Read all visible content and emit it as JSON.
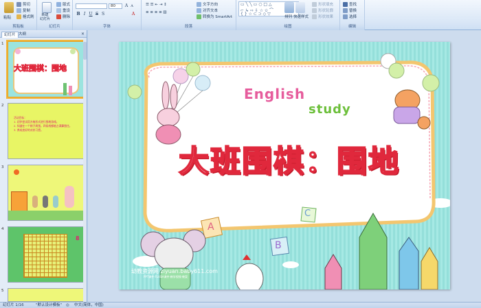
{
  "ribbon": {
    "clipboard": {
      "paste": "粘贴",
      "cut": "剪切",
      "copy": "复制",
      "format_painter": "格式刷",
      "group": "剪贴板"
    },
    "slides": {
      "new_slide": "新建\n幻灯片",
      "layout": "版式",
      "reset": "重设",
      "delete": "删除",
      "group": "幻灯片"
    },
    "font": {
      "font_name": "",
      "font_size": "80",
      "group": "字体"
    },
    "paragraph": {
      "text_direction": "文字方向",
      "align_text": "对齐文本",
      "convert_smartart": "转换为 SmartArt",
      "group": "段落"
    },
    "drawing": {
      "arrange": "排列",
      "quick_styles": "快速样式",
      "shape_fill": "形状填充",
      "shape_outline": "形状轮廓",
      "shape_effects": "形状效果",
      "group": "绘图"
    },
    "editing": {
      "find": "查找",
      "replace": "替换",
      "select": "选择",
      "group": "编辑"
    }
  },
  "panel": {
    "tabs": [
      "幻灯片",
      "大纲"
    ],
    "close": "×",
    "thumbnails": [
      {
        "num": "1",
        "title": "大班围棋：围地"
      },
      {
        "num": "2",
        "lines": [
          "活动目标：",
          "1. 初步尝试用方格形式进行围地游戏。",
          "2. 知道在一个棋子周围，四条线都能占满算围住。",
          "3. 养成良好的对弈习惯。"
        ]
      },
      {
        "num": "3"
      },
      {
        "num": "4",
        "side": "8"
      },
      {
        "num": "5"
      }
    ]
  },
  "slide": {
    "title": "大班围棋：围地",
    "english": "English",
    "study": "study",
    "blocks": [
      "A",
      "B",
      "C"
    ],
    "watermark": "幼教资源网 ziyuan.baby611.com",
    "watermark2": "PPT课件·FLASH课件·教学视频·教案"
  },
  "status": {
    "slide": "幻灯片 1/16",
    "theme": "\"默认设计模板\"",
    "lang": "中文(简体，中国)"
  }
}
